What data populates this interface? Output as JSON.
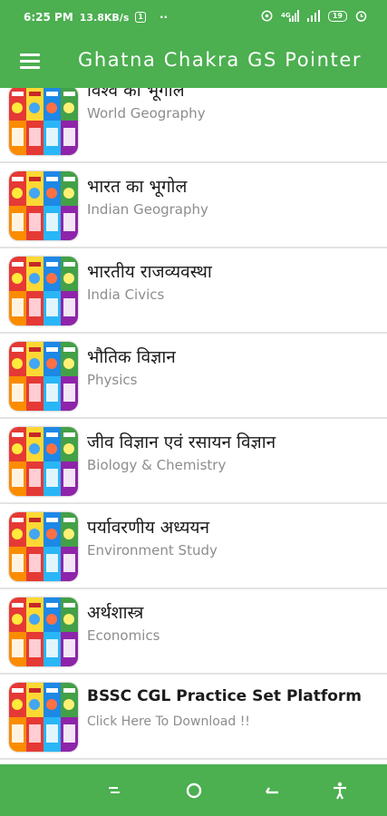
{
  "status_bar": {
    "time": "6:25 PM",
    "speed": "13.8KB/s",
    "sim_badge": "1",
    "dots": "··",
    "network": "4G",
    "battery": "19"
  },
  "app_bar": {
    "menu_icon": "hamburger-menu-icon",
    "title": "Ghatna Chakra GS Pointer"
  },
  "items": [
    {
      "title": "विश्व का भूगोल",
      "subtitle": "World Geography"
    },
    {
      "title": "भारत का भूगोल",
      "subtitle": "Indian Geography"
    },
    {
      "title": "भारतीय राजव्यवस्था",
      "subtitle": "India Civics"
    },
    {
      "title": "भौतिक विज्ञान",
      "subtitle": "Physics"
    },
    {
      "title": "जीव विज्ञान एवं रसायन विज्ञान",
      "subtitle": "Biology & Chemistry"
    },
    {
      "title": "पर्यावरणीय अध्ययन",
      "subtitle": "Environment Study"
    },
    {
      "title": "अर्थशास्त्र",
      "subtitle": "Economics"
    },
    {
      "title": "BSSC CGL Practice Set Platform",
      "subtitle": "Click Here To Download !!"
    }
  ],
  "nav_bar": {
    "icons": [
      "recents-icon",
      "home-icon",
      "back-icon",
      "accessibility-icon"
    ]
  },
  "colors": {
    "primary": "#4caf50",
    "title_text": "#1b1b1b",
    "subtitle_text": "#8d8d8d",
    "divider": "#e3e3e3"
  }
}
